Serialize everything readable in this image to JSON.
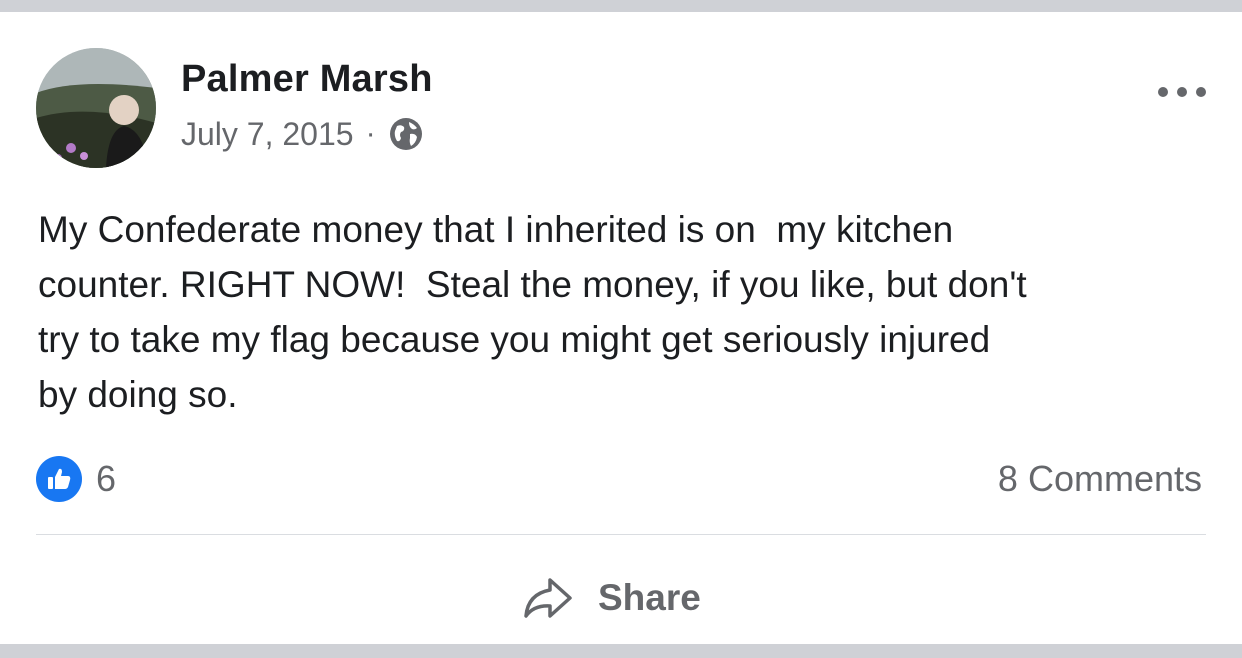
{
  "post": {
    "author": "Palmer Marsh",
    "date": "July 7, 2015",
    "separator": "·",
    "privacy_icon": "globe-icon",
    "text": "My Confederate money that I inherited is on  my kitchen\ncounter. RIGHT NOW!  Steal the money, if you like, but don't\ntry to take my flag because you might get seriously injured\nby doing so.",
    "reaction_icon": "thumbs-up-icon",
    "reaction_count": "6",
    "comments_label": "8 Comments",
    "share_label": "Share"
  },
  "colors": {
    "background": "#cfd1d6",
    "card": "#ffffff",
    "text": "#1c1e21",
    "secondary_text": "#65676b",
    "like_blue": "#1877f2"
  }
}
